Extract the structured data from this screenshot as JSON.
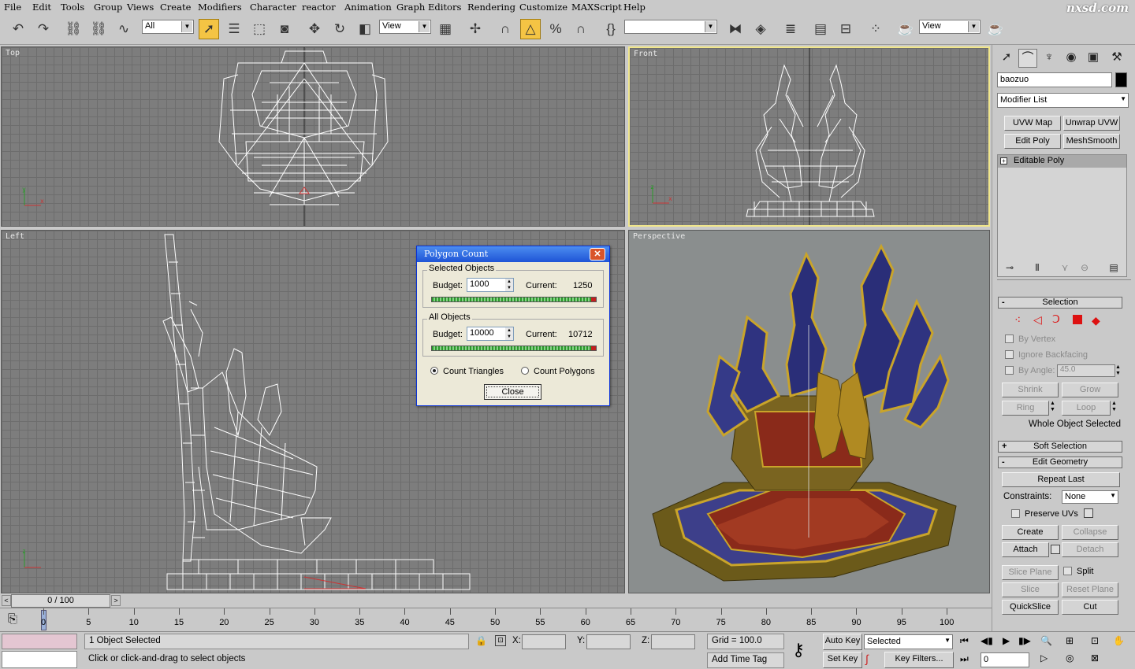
{
  "menu": [
    "File",
    "Edit",
    "Tools",
    "Group",
    "Views",
    "Create",
    "Modifiers",
    "Character",
    "reactor",
    "Animation",
    "Graph Editors",
    "Rendering",
    "Customize",
    "MAXScript",
    "Help"
  ],
  "logo": "nxsd.com",
  "toolbar": {
    "selection_filter": "All",
    "ref_coord": "View",
    "named_sel": "",
    "render_view": "View"
  },
  "viewports": {
    "top": "Top",
    "front": "Front",
    "left": "Left",
    "perspective": "Perspective"
  },
  "dialog": {
    "title": "Polygon Count",
    "selected": {
      "label": "Selected Objects",
      "budget_label": "Budget:",
      "budget": "1000",
      "current_label": "Current:",
      "current": "1250"
    },
    "all": {
      "label": "All Objects",
      "budget_label": "Budget:",
      "budget": "10000",
      "current_label": "Current:",
      "current": "10712"
    },
    "count_triangles": "Count Triangles",
    "count_polygons": "Count Polygons",
    "close": "Close"
  },
  "panel": {
    "object_name": "baozuo",
    "modifier_list": "Modifier List",
    "mod_buttons": [
      "UVW Map",
      "Unwrap UVW",
      "Edit Poly",
      "MeshSmooth"
    ],
    "stack_item": "Editable Poly",
    "selection": {
      "header": "Selection",
      "by_vertex": "By Vertex",
      "ignore_backfacing": "Ignore Backfacing",
      "by_angle": "By Angle:",
      "angle_value": "45.0",
      "shrink": "Shrink",
      "grow": "Grow",
      "ring": "Ring",
      "loop": "Loop",
      "status": "Whole Object Selected"
    },
    "soft_selection": "Soft Selection",
    "edit_geometry": {
      "header": "Edit Geometry",
      "repeat_last": "Repeat Last",
      "constraints_label": "Constraints:",
      "constraints": "None",
      "preserve_uvs": "Preserve UVs",
      "create": "Create",
      "collapse": "Collapse",
      "attach": "Attach",
      "detach": "Detach",
      "slice_plane": "Slice Plane",
      "split": "Split",
      "slice": "Slice",
      "reset_plane": "Reset Plane",
      "quickslice": "QuickSlice",
      "cut": "Cut"
    }
  },
  "timeline": {
    "frame": "0 / 100",
    "ticks": [
      "0",
      "5",
      "10",
      "15",
      "20",
      "25",
      "30",
      "35",
      "40",
      "45",
      "50",
      "55",
      "60",
      "65",
      "70",
      "75",
      "80",
      "85",
      "90",
      "95",
      "100"
    ]
  },
  "status": {
    "selected": "1 Object Selected",
    "prompt": "Click or click-and-drag to select objects",
    "x_label": "X:",
    "y_label": "Y:",
    "z_label": "Z:",
    "grid": "Grid = 100.0",
    "add_time_tag": "Add Time Tag",
    "auto_key": "Auto Key",
    "set_key": "Set Key",
    "key_mode": "Selected",
    "key_filters": "Key Filters...",
    "frame_field": "0"
  }
}
